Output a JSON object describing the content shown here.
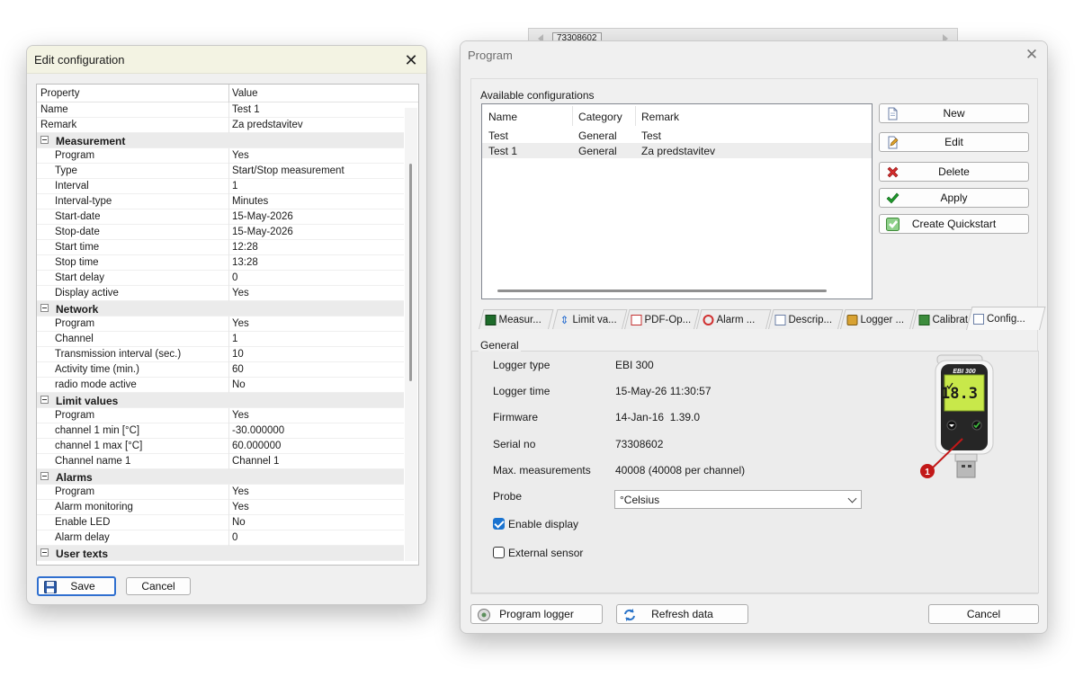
{
  "background": {
    "serial_tab": "73308602"
  },
  "edit_config": {
    "title": "Edit configuration",
    "grid_header": {
      "property": "Property",
      "value": "Value"
    },
    "top_rows": [
      {
        "name": "Name",
        "value": "Test 1"
      },
      {
        "name": "Remark",
        "value": "Za predstavitev"
      }
    ],
    "measurement": {
      "label": "Measurement",
      "rows": [
        {
          "name": "Program",
          "value": "Yes"
        },
        {
          "name": "Type",
          "value": "Start/Stop measurement"
        },
        {
          "name": "Interval",
          "value": "1"
        },
        {
          "name": "Interval-type",
          "value": "Minutes"
        },
        {
          "name": "Start-date",
          "value": "15-May-2026"
        },
        {
          "name": "Stop-date",
          "value": "15-May-2026"
        },
        {
          "name": "Start time",
          "value": "12:28"
        },
        {
          "name": "Stop time",
          "value": "13:28"
        },
        {
          "name": "Start delay",
          "value": "0"
        },
        {
          "name": "Display active",
          "value": "Yes"
        }
      ]
    },
    "network": {
      "label": "Network",
      "rows": [
        {
          "name": "Program",
          "value": "Yes"
        },
        {
          "name": "Channel",
          "value": "1"
        },
        {
          "name": "Transmission interval (sec.)",
          "value": "10"
        },
        {
          "name": "Activity time (min.)",
          "value": "60"
        },
        {
          "name": "radio mode active",
          "value": "No"
        }
      ]
    },
    "limit_values": {
      "label": "Limit values",
      "rows": [
        {
          "name": "Program",
          "value": "Yes"
        },
        {
          "name": "channel 1 min [°C]",
          "value": "-30.000000"
        },
        {
          "name": "channel 1 max [°C]",
          "value": "60.000000"
        },
        {
          "name": "Channel name 1",
          "value": "Channel 1"
        }
      ]
    },
    "alarms": {
      "label": "Alarms",
      "rows": [
        {
          "name": "Program",
          "value": "Yes"
        },
        {
          "name": "Alarm monitoring",
          "value": "Yes"
        },
        {
          "name": "Enable LED",
          "value": "No"
        },
        {
          "name": "Alarm delay",
          "value": "0"
        }
      ]
    },
    "user_texts": {
      "label": "User texts"
    },
    "save_label": "Save",
    "cancel_label": "Cancel"
  },
  "program": {
    "title": "Program",
    "available_label": "Available configurations",
    "list_columns": {
      "name": "Name",
      "category": "Category",
      "remark": "Remark"
    },
    "configs": [
      {
        "name": "Test",
        "category": "General",
        "remark": "Test"
      },
      {
        "name": "Test 1",
        "category": "General",
        "remark": "Za predstavitev"
      }
    ],
    "buttons": {
      "new": "New",
      "edit": "Edit",
      "delete": "Delete",
      "apply": "Apply",
      "quickstart": "Create Quickstart",
      "program_logger": "Program logger",
      "refresh": "Refresh data",
      "cancel": "Cancel"
    },
    "tabs": [
      "Measur...",
      "Limit va...",
      "PDF-Op...",
      "Alarm ...",
      "Descrip...",
      "Logger ...",
      "Calibrat...",
      "Config..."
    ],
    "general": {
      "label": "General",
      "logger_type_label": "Logger type",
      "logger_type": "EBI 300",
      "logger_time_label": "Logger time",
      "logger_time": "15-May-26 11:30:57",
      "firmware_label": "Firmware",
      "firmware": "14-Jan-16  1.39.0",
      "serial_label": "Serial no",
      "serial": "73308602",
      "maxmeas_label": "Max. measurements",
      "maxmeas": "40008 (40008 per channel)",
      "probe_label": "Probe",
      "probe_value": "°Celsius",
      "enable_display_label": "Enable display",
      "external_sensor_label": "External sensor"
    },
    "device": {
      "model": "EBI 300",
      "reading": "18.3",
      "callout": "1"
    },
    "colors": {
      "accent": "#1a73d0",
      "delete_red": "#d22c2c",
      "apply_green": "#1e9a2b",
      "callout": "#c21818"
    }
  }
}
